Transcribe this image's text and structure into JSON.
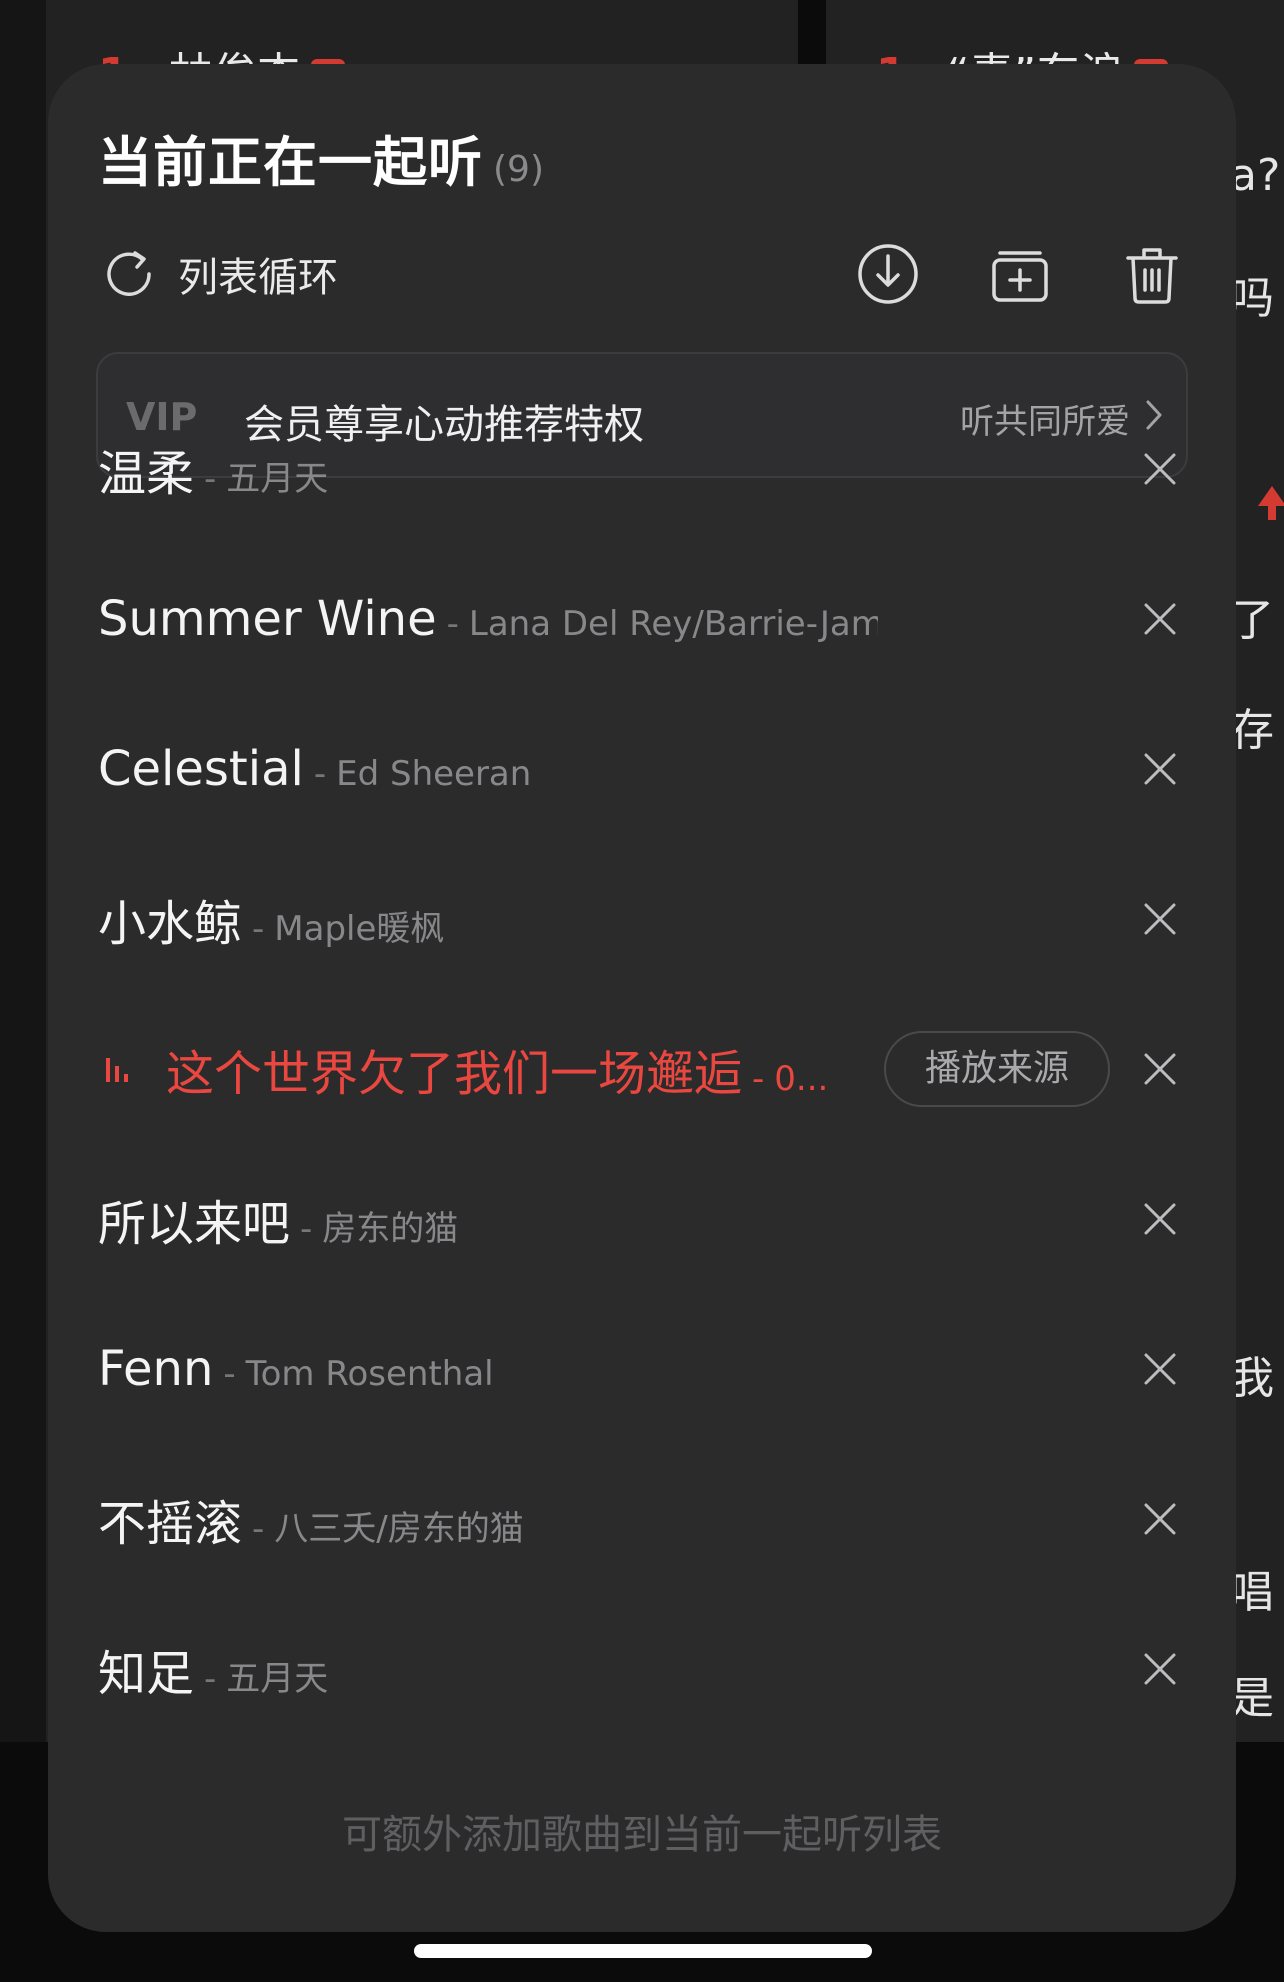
{
  "background": {
    "left_top": {
      "rank": "1",
      "text": "林俊杰",
      "badge": "热"
    },
    "right_top": {
      "rank": "1",
      "text": "“毒”东浪",
      "badge": "热"
    },
    "side_fragments": [
      "a?",
      "吗",
      "了",
      "存",
      "我",
      "唱",
      "是"
    ]
  },
  "sheet": {
    "title": "当前正在一起听",
    "count": "(9)",
    "play_mode_label": "列表循环",
    "vip": {
      "logo": "VIP",
      "text": "会员尊享心动推荐特权",
      "link": "听共同所爱"
    },
    "songs": [
      {
        "title": "温柔",
        "artist": "五月天",
        "active": false
      },
      {
        "title": "Summer Wine",
        "artist": "Lana Del Rey/Barrie-James",
        "active": false
      },
      {
        "title": "Celestial",
        "artist": "Ed Sheeran",
        "active": false
      },
      {
        "title": "小水鲸",
        "artist": "Maple暖枫",
        "active": false
      },
      {
        "title": "这个世界欠了我们一场邂逅",
        "artist": "0...",
        "active": true,
        "source_label": "播放来源"
      },
      {
        "title": "所以来吧",
        "artist": "房东的猫",
        "active": false
      },
      {
        "title": "Fenn",
        "artist": "Tom Rosenthal",
        "active": false
      },
      {
        "title": "不摇滚",
        "artist": "八三夭/房东的猫",
        "active": false
      },
      {
        "title": "知足",
        "artist": "五月天",
        "active": false
      }
    ],
    "footer_hint": "可额外添加歌曲到当前一起听列表"
  },
  "colors": {
    "accent": "#e9473f",
    "sheet_bg": "#2b2b2c",
    "text_primary": "#f4f4f4",
    "text_secondary": "#88888b"
  }
}
